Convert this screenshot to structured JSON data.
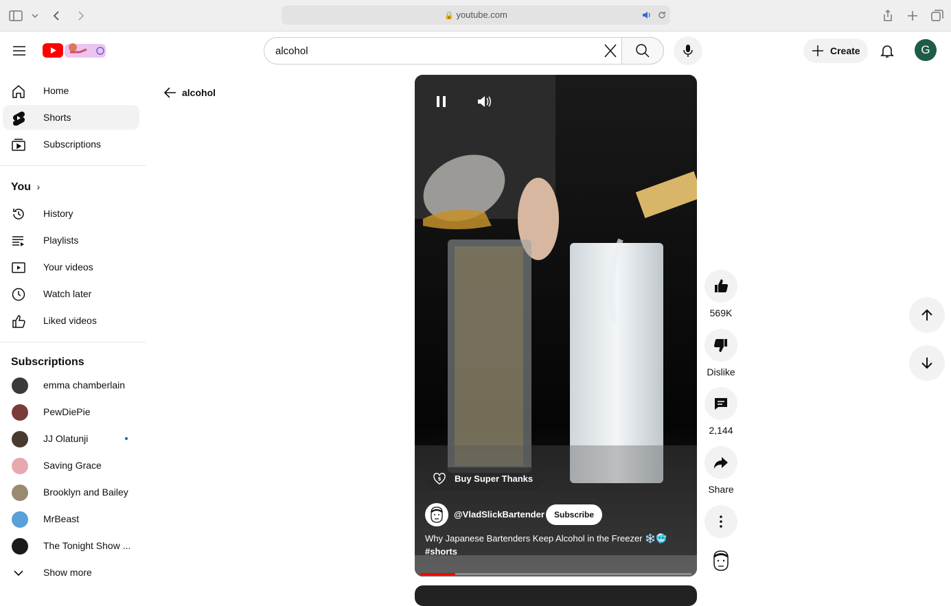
{
  "browser": {
    "url": "youtube.com"
  },
  "search": {
    "value": "alcohol"
  },
  "header": {
    "create_label": "Create",
    "avatar_letter": "G"
  },
  "sidebar": {
    "main": [
      {
        "label": "Home",
        "icon": "home-icon"
      },
      {
        "label": "Shorts",
        "icon": "shorts-icon",
        "active": true
      },
      {
        "label": "Subscriptions",
        "icon": "subscriptions-icon"
      }
    ],
    "you_heading": "You",
    "you": [
      {
        "label": "History",
        "icon": "history-icon"
      },
      {
        "label": "Playlists",
        "icon": "playlists-icon"
      },
      {
        "label": "Your videos",
        "icon": "your-videos-icon"
      },
      {
        "label": "Watch later",
        "icon": "watch-later-icon"
      },
      {
        "label": "Liked videos",
        "icon": "liked-videos-icon"
      }
    ],
    "subs_heading": "Subscriptions",
    "subscriptions": [
      {
        "label": "emma chamberlain",
        "color": "#3a3a3a"
      },
      {
        "label": "PewDiePie",
        "color": "#7a3b3b"
      },
      {
        "label": "JJ Olatunji",
        "color": "#4a3a2e",
        "live": true
      },
      {
        "label": "Saving Grace",
        "color": "#e8a8b0"
      },
      {
        "label": "Brooklyn and Bailey",
        "color": "#9a8a70"
      },
      {
        "label": "MrBeast",
        "color": "#5aa0d8"
      },
      {
        "label": "The Tonight Show ...",
        "color": "#1a1a1a"
      }
    ],
    "show_more": "Show more"
  },
  "back": {
    "label": "alcohol"
  },
  "short": {
    "super_thanks": "Buy Super Thanks",
    "channel": "@VladSlickBartender",
    "subscribe": "Subscribe",
    "title": "Why Japanese Bartenders Keep Alcohol in the Freezer ❄️🥶",
    "hashtag": "#shorts",
    "progress": 0.13
  },
  "actions": {
    "likes": "569K",
    "dislike": "Dislike",
    "comments": "2,144",
    "share": "Share"
  }
}
